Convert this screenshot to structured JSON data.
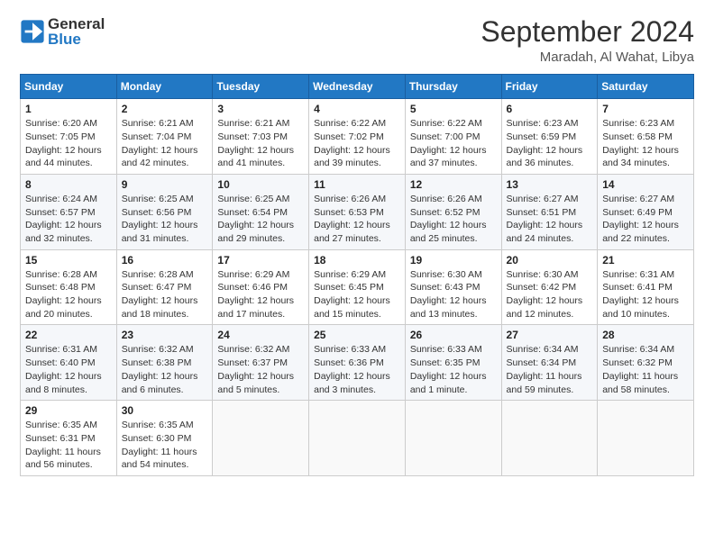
{
  "logo": {
    "general": "General",
    "blue": "Blue"
  },
  "header": {
    "month": "September 2024",
    "location": "Maradah, Al Wahat, Libya"
  },
  "weekdays": [
    "Sunday",
    "Monday",
    "Tuesday",
    "Wednesday",
    "Thursday",
    "Friday",
    "Saturday"
  ],
  "weeks": [
    [
      {
        "day": "1",
        "info": "Sunrise: 6:20 AM\nSunset: 7:05 PM\nDaylight: 12 hours\nand 44 minutes."
      },
      {
        "day": "2",
        "info": "Sunrise: 6:21 AM\nSunset: 7:04 PM\nDaylight: 12 hours\nand 42 minutes."
      },
      {
        "day": "3",
        "info": "Sunrise: 6:21 AM\nSunset: 7:03 PM\nDaylight: 12 hours\nand 41 minutes."
      },
      {
        "day": "4",
        "info": "Sunrise: 6:22 AM\nSunset: 7:02 PM\nDaylight: 12 hours\nand 39 minutes."
      },
      {
        "day": "5",
        "info": "Sunrise: 6:22 AM\nSunset: 7:00 PM\nDaylight: 12 hours\nand 37 minutes."
      },
      {
        "day": "6",
        "info": "Sunrise: 6:23 AM\nSunset: 6:59 PM\nDaylight: 12 hours\nand 36 minutes."
      },
      {
        "day": "7",
        "info": "Sunrise: 6:23 AM\nSunset: 6:58 PM\nDaylight: 12 hours\nand 34 minutes."
      }
    ],
    [
      {
        "day": "8",
        "info": "Sunrise: 6:24 AM\nSunset: 6:57 PM\nDaylight: 12 hours\nand 32 minutes."
      },
      {
        "day": "9",
        "info": "Sunrise: 6:25 AM\nSunset: 6:56 PM\nDaylight: 12 hours\nand 31 minutes."
      },
      {
        "day": "10",
        "info": "Sunrise: 6:25 AM\nSunset: 6:54 PM\nDaylight: 12 hours\nand 29 minutes."
      },
      {
        "day": "11",
        "info": "Sunrise: 6:26 AM\nSunset: 6:53 PM\nDaylight: 12 hours\nand 27 minutes."
      },
      {
        "day": "12",
        "info": "Sunrise: 6:26 AM\nSunset: 6:52 PM\nDaylight: 12 hours\nand 25 minutes."
      },
      {
        "day": "13",
        "info": "Sunrise: 6:27 AM\nSunset: 6:51 PM\nDaylight: 12 hours\nand 24 minutes."
      },
      {
        "day": "14",
        "info": "Sunrise: 6:27 AM\nSunset: 6:49 PM\nDaylight: 12 hours\nand 22 minutes."
      }
    ],
    [
      {
        "day": "15",
        "info": "Sunrise: 6:28 AM\nSunset: 6:48 PM\nDaylight: 12 hours\nand 20 minutes."
      },
      {
        "day": "16",
        "info": "Sunrise: 6:28 AM\nSunset: 6:47 PM\nDaylight: 12 hours\nand 18 minutes."
      },
      {
        "day": "17",
        "info": "Sunrise: 6:29 AM\nSunset: 6:46 PM\nDaylight: 12 hours\nand 17 minutes."
      },
      {
        "day": "18",
        "info": "Sunrise: 6:29 AM\nSunset: 6:45 PM\nDaylight: 12 hours\nand 15 minutes."
      },
      {
        "day": "19",
        "info": "Sunrise: 6:30 AM\nSunset: 6:43 PM\nDaylight: 12 hours\nand 13 minutes."
      },
      {
        "day": "20",
        "info": "Sunrise: 6:30 AM\nSunset: 6:42 PM\nDaylight: 12 hours\nand 12 minutes."
      },
      {
        "day": "21",
        "info": "Sunrise: 6:31 AM\nSunset: 6:41 PM\nDaylight: 12 hours\nand 10 minutes."
      }
    ],
    [
      {
        "day": "22",
        "info": "Sunrise: 6:31 AM\nSunset: 6:40 PM\nDaylight: 12 hours\nand 8 minutes."
      },
      {
        "day": "23",
        "info": "Sunrise: 6:32 AM\nSunset: 6:38 PM\nDaylight: 12 hours\nand 6 minutes."
      },
      {
        "day": "24",
        "info": "Sunrise: 6:32 AM\nSunset: 6:37 PM\nDaylight: 12 hours\nand 5 minutes."
      },
      {
        "day": "25",
        "info": "Sunrise: 6:33 AM\nSunset: 6:36 PM\nDaylight: 12 hours\nand 3 minutes."
      },
      {
        "day": "26",
        "info": "Sunrise: 6:33 AM\nSunset: 6:35 PM\nDaylight: 12 hours\nand 1 minute."
      },
      {
        "day": "27",
        "info": "Sunrise: 6:34 AM\nSunset: 6:34 PM\nDaylight: 11 hours\nand 59 minutes."
      },
      {
        "day": "28",
        "info": "Sunrise: 6:34 AM\nSunset: 6:32 PM\nDaylight: 11 hours\nand 58 minutes."
      }
    ],
    [
      {
        "day": "29",
        "info": "Sunrise: 6:35 AM\nSunset: 6:31 PM\nDaylight: 11 hours\nand 56 minutes."
      },
      {
        "day": "30",
        "info": "Sunrise: 6:35 AM\nSunset: 6:30 PM\nDaylight: 11 hours\nand 54 minutes."
      },
      {
        "day": "",
        "info": ""
      },
      {
        "day": "",
        "info": ""
      },
      {
        "day": "",
        "info": ""
      },
      {
        "day": "",
        "info": ""
      },
      {
        "day": "",
        "info": ""
      }
    ]
  ]
}
